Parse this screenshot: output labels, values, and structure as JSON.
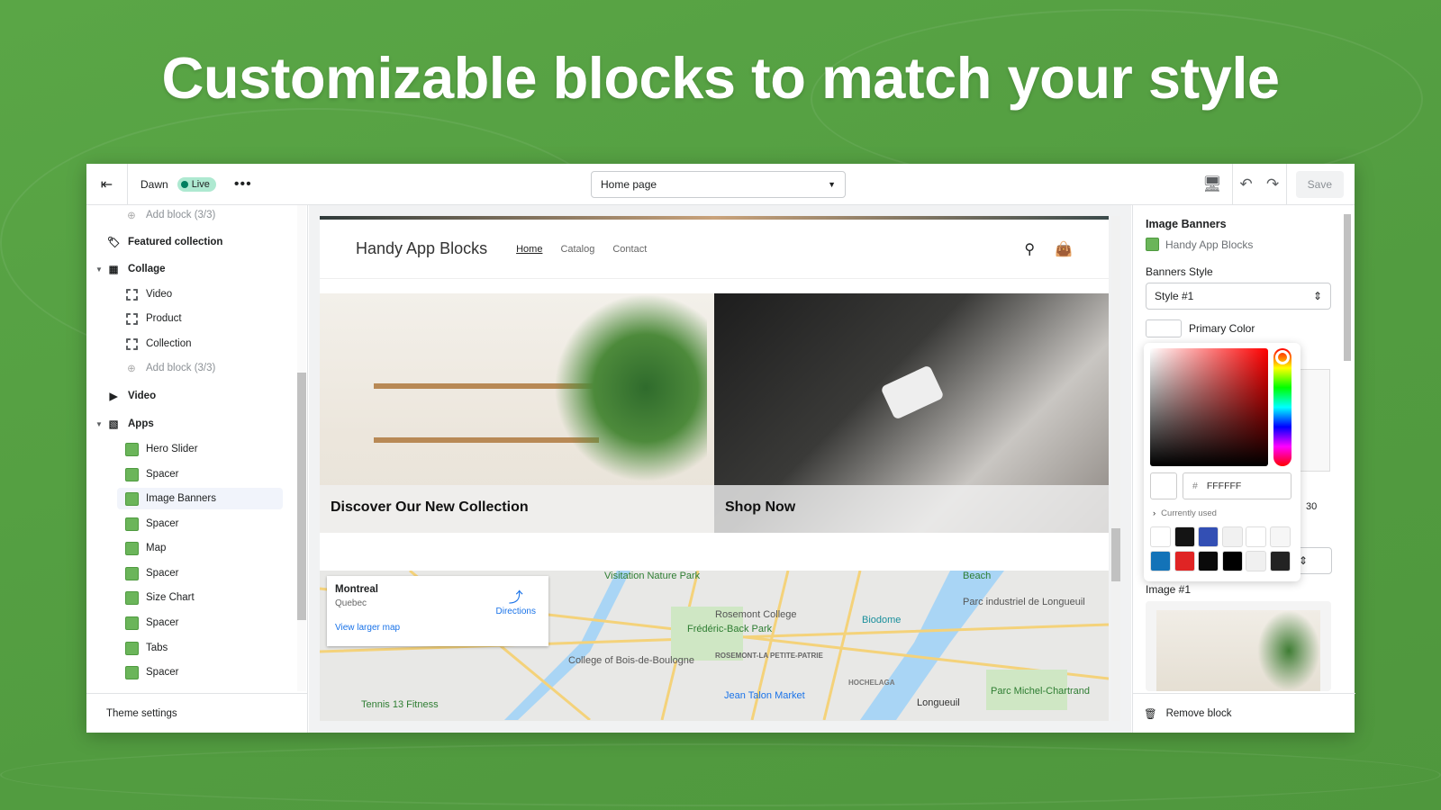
{
  "headline": "Customizable blocks to match your style",
  "topbar": {
    "theme": "Dawn",
    "status": "Live",
    "page_select": "Home page",
    "save": "Save"
  },
  "sidebar": {
    "items": [
      {
        "label": "Add block (3/3)",
        "kind": "add"
      },
      {
        "label": "Featured collection",
        "kind": "section"
      },
      {
        "label": "Collage",
        "kind": "section"
      },
      {
        "label": "Video",
        "kind": "block"
      },
      {
        "label": "Product",
        "kind": "block"
      },
      {
        "label": "Collection",
        "kind": "block"
      },
      {
        "label": "Add block (3/3)",
        "kind": "add"
      },
      {
        "label": "Video",
        "kind": "section"
      },
      {
        "label": "Apps",
        "kind": "section"
      },
      {
        "label": "Hero Slider",
        "kind": "app"
      },
      {
        "label": "Spacer",
        "kind": "app"
      },
      {
        "label": "Image Banners",
        "kind": "app",
        "selected": true
      },
      {
        "label": "Spacer",
        "kind": "app"
      },
      {
        "label": "Map",
        "kind": "app"
      },
      {
        "label": "Spacer",
        "kind": "app"
      },
      {
        "label": "Size Chart",
        "kind": "app"
      },
      {
        "label": "Spacer",
        "kind": "app"
      },
      {
        "label": "Tabs",
        "kind": "app"
      },
      {
        "label": "Spacer",
        "kind": "app"
      }
    ],
    "theme_settings": "Theme settings"
  },
  "preview": {
    "brand": "Handy App Blocks",
    "nav": [
      "Home",
      "Catalog",
      "Contact"
    ],
    "banners": [
      "Discover Our New Collection",
      "Shop Now"
    ],
    "map": {
      "place": "Montreal",
      "region": "Quebec",
      "directions": "Directions",
      "larger": "View larger map",
      "labels": [
        "Visitation Nature Park",
        "Rosemont College",
        "Frédéric-Back Park",
        "Biodome",
        "College of Bois-de-Boulogne",
        "Tennis 13 Fitness",
        "Jean Talon Market",
        "Parc industriel de Longueuil",
        "Parc Michel-Chartrand",
        "Longueuil",
        "ROSEMONT-LA PETITE-PATRIE",
        "HOCHELAGA",
        "Beach"
      ]
    }
  },
  "panel": {
    "title": "Image Banners",
    "app": "Handy App Blocks",
    "style_label": "Banners Style",
    "style_value": "Style #1",
    "primary_color": "Primary Color",
    "hex_prefix": "#",
    "hex": "FFFFFF",
    "currently_used": "Currently used",
    "swatches": [
      "#ffffff",
      "#141414",
      "#334fb4",
      "#f1f1f1",
      "#ffffff",
      "#f6f6f6",
      "#1373b8",
      "#e02424",
      "#0a0a0a",
      "#000000",
      "#f0f0f0",
      "#232323"
    ],
    "range_value": "30",
    "image_label": "Image #1",
    "remove": "Remove block"
  }
}
